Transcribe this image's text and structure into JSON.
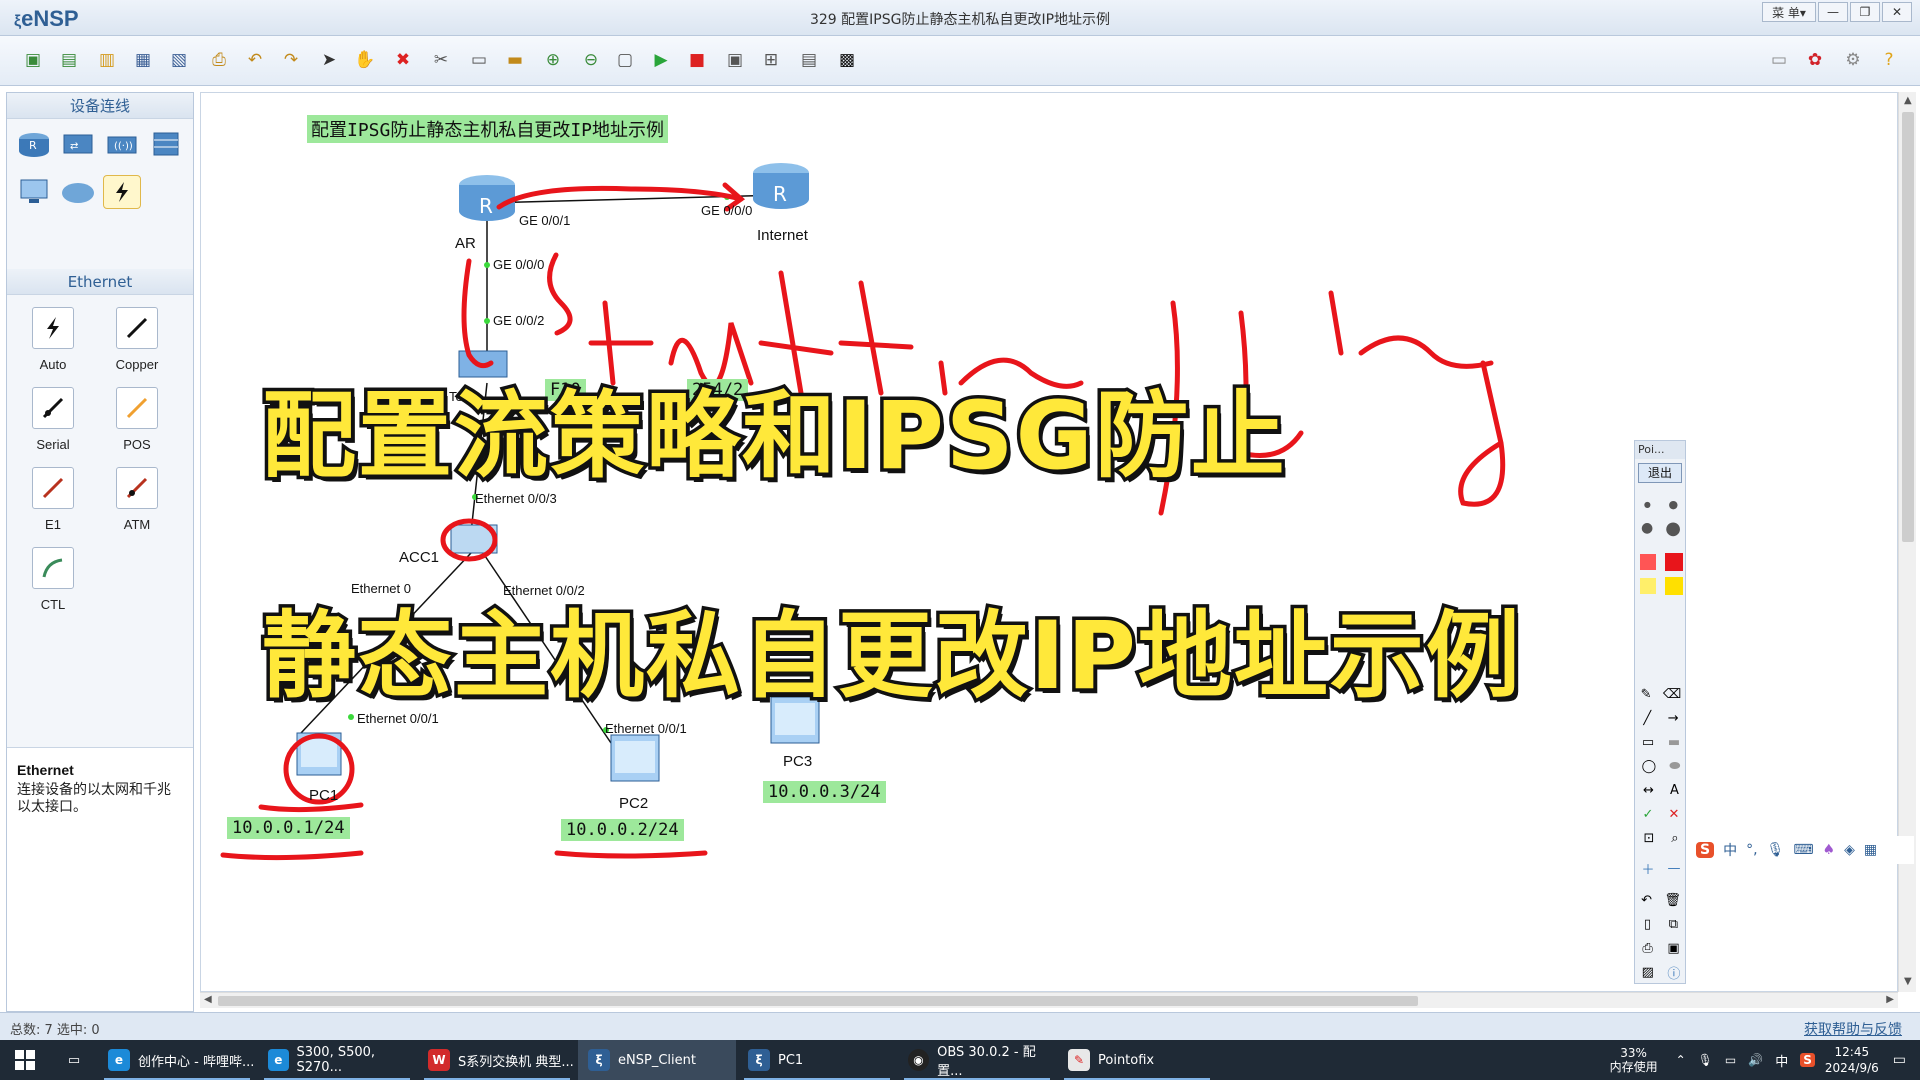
{
  "window": {
    "app_name": "eNSP",
    "title": "329 配置IPSG防止静态主机私自更改IP地址示例",
    "menu_label": "菜 单▾",
    "minimize": "—",
    "restore": "❐",
    "close": "✕"
  },
  "left_panel": {
    "devices_header": "设备连线",
    "ethernet_header": "Ethernet",
    "cables": [
      {
        "label": "Auto"
      },
      {
        "label": "Copper"
      },
      {
        "label": "Serial"
      },
      {
        "label": "POS"
      },
      {
        "label": "E1"
      },
      {
        "label": "ATM"
      },
      {
        "label": "CTL"
      }
    ],
    "info_title": "Ethernet",
    "info_text": "连接设备的以太网和千兆以太接口。"
  },
  "topology": {
    "title": "配置IPSG防止静态主机私自更改IP地址示例",
    "nodes": {
      "ar": "AR",
      "internet": "Internet",
      "acc1": "ACC1",
      "pc1": "PC1",
      "pc2": "PC2",
      "pc3": "PC3",
      "core_partial": "Te"
    },
    "ports": {
      "ar_ge001": "GE 0/0/1",
      "internet_ge000": "GE 0/0/0",
      "ar_ge000": "GE 0/0/0",
      "sw_ge002": "GE 0/0/2",
      "sw_g_partial": "G",
      "acc_eth003": "Ethernet 0/0/3",
      "acc_eth001": "Ethernet 0",
      "acc_eth002": "Ethernet 0/0/2",
      "pc1_eth": "Ethernet 0/0/1",
      "pc2_eth": "Ethernet 0/0/1"
    },
    "ip_labels": {
      "pc1": "10.0.0.1/24",
      "pc2": "10.0.0.2/24",
      "pc3": "10.0.0.3/24",
      "vlanif_partial": "F10",
      "vlanif_partial2": "254/2"
    }
  },
  "captions": {
    "line1": "配置流策略和IPSG防止",
    "line2": "静态主机私自更改IP地址示例"
  },
  "pointofix": {
    "title": "Poi...",
    "exit": "退出"
  },
  "status": {
    "left": "总数: 7  选中: 0",
    "right": "获取帮助与反馈"
  },
  "taskbar": {
    "items": [
      {
        "label": "创作中心 - 哔哩哔..."
      },
      {
        "label": "S300, S500, S270..."
      },
      {
        "label": "S系列交换机 典型..."
      },
      {
        "label": "eNSP_Client"
      },
      {
        "label": "PC1"
      },
      {
        "label": "OBS 30.0.2 - 配置..."
      },
      {
        "label": "Pointofix"
      }
    ],
    "mem_percent": "33%",
    "mem_label": "内存使用",
    "ime_lang": "中",
    "time": "12:45",
    "date": "2024/9/6"
  },
  "colors": {
    "label_bg": "#9de89b",
    "annotation_red": "#e8151b",
    "caption_yellow": "#ffe83a",
    "accent": "#2f5f94"
  }
}
